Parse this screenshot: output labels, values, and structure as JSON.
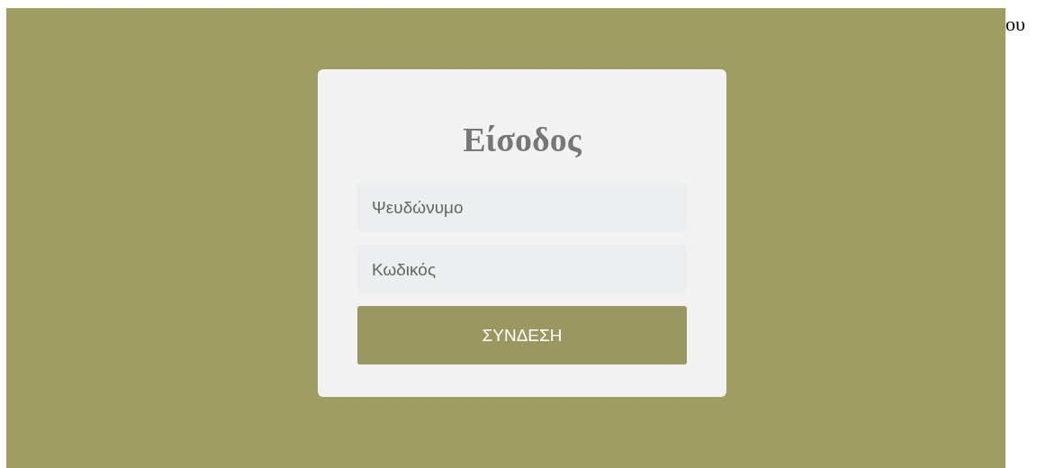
{
  "login_card": {
    "title": "Είσοδος",
    "username": {
      "placeholder": "Ψευδώνυμο"
    },
    "password": {
      "placeholder": "Κωδικός"
    },
    "submit_button": "ΣΥΝΔΕΣΗ"
  },
  "page_text": "ου"
}
